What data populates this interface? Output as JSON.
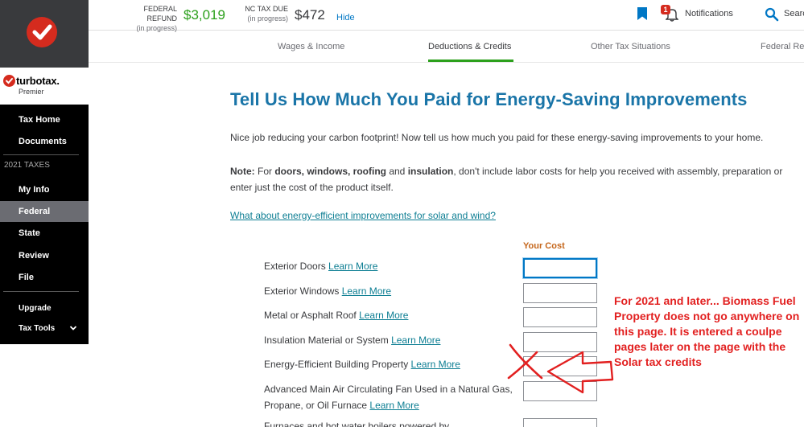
{
  "summary": {
    "federal_label": "FEDERAL REFUND",
    "federal_sub": "(in progress)",
    "federal_amount": "$3,019",
    "state_label": "NC TAX DUE",
    "state_sub": "(in progress)",
    "state_amount": "$472",
    "hide": "Hide",
    "federal_color": "#2ca01c",
    "state_color": "#393a3d"
  },
  "header": {
    "notifications_badge": "1",
    "notifications": "Notifications",
    "search": "Search"
  },
  "brand": {
    "name": "turbotax.",
    "edition": "Premier",
    "red": "#d52b1e"
  },
  "sidebar": {
    "items_top": [
      {
        "label": "Tax Home"
      },
      {
        "label": "Documents"
      }
    ],
    "section": "2021 TAXES",
    "items": [
      {
        "label": "My Info"
      },
      {
        "label": "Federal"
      },
      {
        "label": "State"
      },
      {
        "label": "Review"
      },
      {
        "label": "File"
      }
    ],
    "items_bottom": [
      {
        "label": "Upgrade"
      },
      {
        "label": "Tax Tools"
      }
    ],
    "active": "Federal"
  },
  "tabs": [
    {
      "label": "Wages & Income"
    },
    {
      "label": "Deductions & Credits"
    },
    {
      "label": "Other Tax Situations"
    },
    {
      "label": "Federal Review"
    }
  ],
  "active_tab": "Deductions & Credits",
  "main": {
    "title": "Tell Us How Much You Paid for Energy-Saving Improvements",
    "intro": "Nice job reducing your carbon footprint! Now tell us how much you paid for these energy-saving improvements to your home.",
    "note_label": "Note:",
    "note_for": " For ",
    "note_items": "doors, windows, roofing",
    "note_and": " and ",
    "note_insulation": "insulation",
    "note_rest1": ", don't include labor costs for help you received with assembly, preparation or",
    "note_rest2": "enter just the cost of the product itself.",
    "solar_link": "What about energy-efficient improvements for solar and wind?",
    "cost_header": "Your Cost",
    "learn_more": "Learn More",
    "rows": [
      {
        "label": "Exterior Doors",
        "value": ""
      },
      {
        "label": "Exterior Windows",
        "value": ""
      },
      {
        "label": "Metal or Asphalt Roof",
        "value": ""
      },
      {
        "label": "Insulation Material or System",
        "value": ""
      },
      {
        "label": "Energy-Efficient Building Property",
        "value": ""
      },
      {
        "label": "Advanced Main Air Circulating Fan Used in a Natural Gas,",
        "label2": "Propane, or Oil Furnace",
        "value": ""
      },
      {
        "label": "Furnaces and hot water boilers powered by",
        "value": ""
      }
    ]
  },
  "annotation": {
    "text": "For 2021 and later... Biomass Fuel Property does not go anywhere on this page. It is entered a coulpe pages later on the page with the Solar tax credits",
    "color": "#e22020"
  }
}
